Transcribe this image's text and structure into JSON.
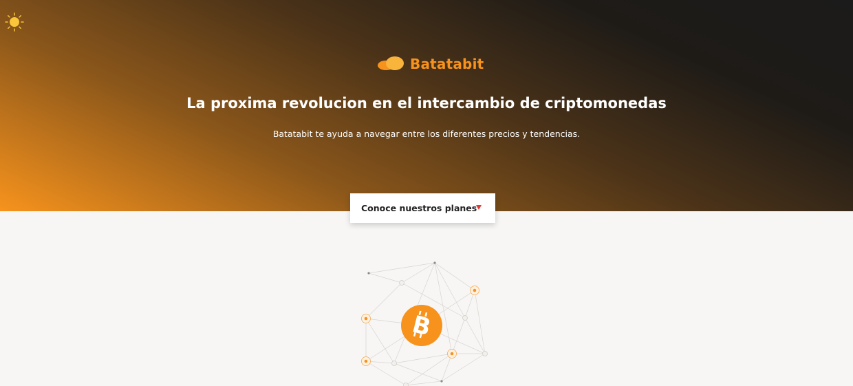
{
  "theme_toggle": {
    "icon": "sun-icon"
  },
  "brand": {
    "name": "Batatabit",
    "logo_icon": "potato-logo-icon",
    "color": "#f7931d"
  },
  "hero": {
    "title": "La proxima revolucion en el intercambio de criptomonedas",
    "subtitle": "Batatabit te ayuda a navegar entre los diferentes precios y tendencias."
  },
  "cta": {
    "label": "Conoce nuestros planes",
    "icon": "triangle-down-icon",
    "icon_color": "#e53935"
  },
  "illustration": {
    "icon": "bitcoin-icon",
    "accent": "#f7931d"
  }
}
